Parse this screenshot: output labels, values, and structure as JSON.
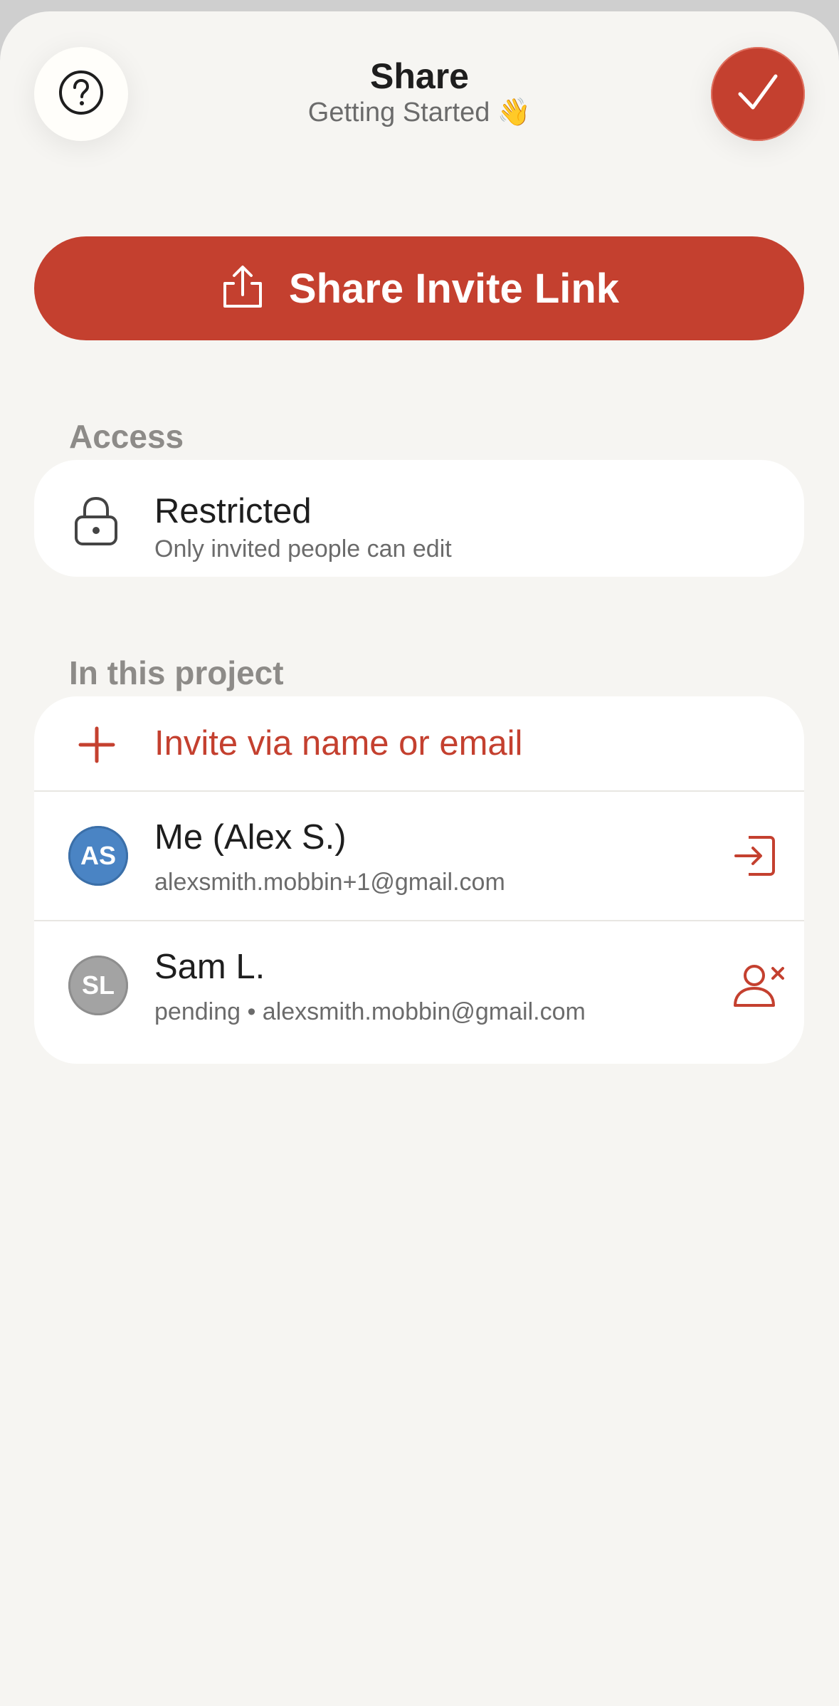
{
  "header": {
    "title": "Share",
    "subtitle": "Getting Started 👋"
  },
  "icons": {
    "help": "help-icon",
    "done": "checkmark-icon",
    "share": "share-upload-icon",
    "lock": "lock-icon",
    "add": "plus-icon",
    "leave": "leave-project-icon",
    "remove_user": "remove-user-icon"
  },
  "colors": {
    "accent": "#c4402f",
    "background": "#f6f5f2",
    "card": "#ffffff",
    "avatar_me": "#4a84c4",
    "avatar_pending": "#a3a3a3"
  },
  "share_link_button": {
    "label": "Share Invite Link"
  },
  "access": {
    "section_label": "Access",
    "title": "Restricted",
    "description": "Only invited people can edit"
  },
  "project": {
    "section_label": "In this project",
    "invite_label": "Invite via name or email",
    "members": [
      {
        "initials": "AS",
        "name": "Me (Alex S.)",
        "detail": "alexsmith.mobbin+1@gmail.com"
      },
      {
        "initials": "SL",
        "name": "Sam L.",
        "detail": "pending • alexsmith.mobbin@gmail.com"
      }
    ]
  }
}
